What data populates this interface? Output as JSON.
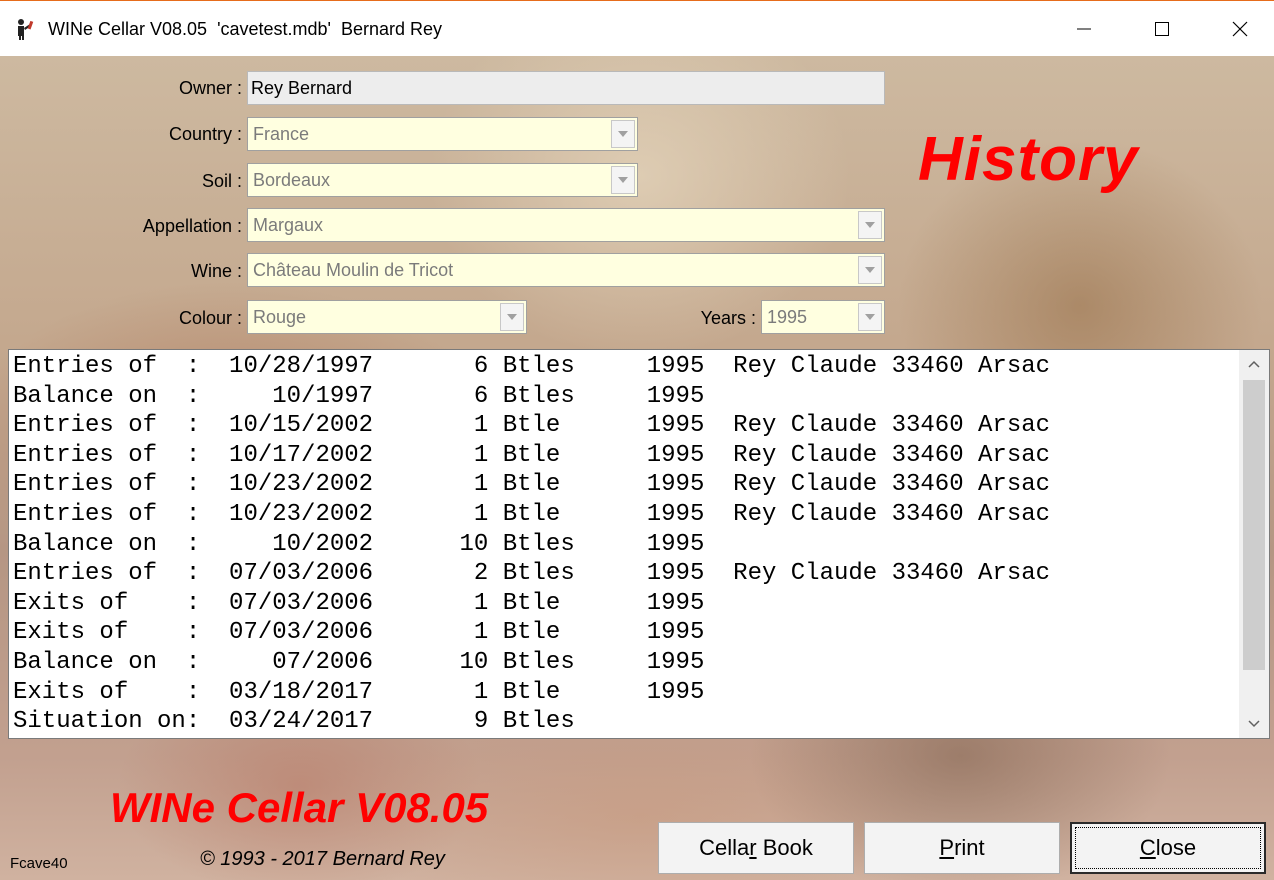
{
  "window": {
    "title": "WINe Cellar V08.05  'cavetest.mdb'  Bernard Rey",
    "controls": [
      "minimize-icon",
      "maximize-icon",
      "close-icon"
    ]
  },
  "form": {
    "owner": {
      "label": "Owner :",
      "value": "Rey Bernard"
    },
    "country": {
      "label": "Country :",
      "value": "France"
    },
    "soil": {
      "label": "Soil :",
      "value": "Bordeaux"
    },
    "appellation": {
      "label": "Appellation :",
      "value": "Margaux"
    },
    "wine": {
      "label": "Wine :",
      "value": "Château Moulin de Tricot"
    },
    "colour": {
      "label": "Colour :",
      "value": "Rouge"
    },
    "years": {
      "label": "Years :",
      "value": "1995"
    }
  },
  "heading": "History",
  "history": {
    "rows": [
      {
        "label": "Entries of  :",
        "date": "10/28/1997",
        "qty": " 6",
        "unit": "Btles",
        "year": "1995",
        "supplier": "Rey Claude 33460 Arsac"
      },
      {
        "label": "Balance on  :",
        "date": "   10/1997",
        "qty": " 6",
        "unit": "Btles",
        "year": "1995",
        "supplier": ""
      },
      {
        "label": "Entries of  :",
        "date": "10/15/2002",
        "qty": " 1",
        "unit": "Btle ",
        "year": "1995",
        "supplier": "Rey Claude 33460 Arsac"
      },
      {
        "label": "Entries of  :",
        "date": "10/17/2002",
        "qty": " 1",
        "unit": "Btle ",
        "year": "1995",
        "supplier": "Rey Claude 33460 Arsac"
      },
      {
        "label": "Entries of  :",
        "date": "10/23/2002",
        "qty": " 1",
        "unit": "Btle ",
        "year": "1995",
        "supplier": "Rey Claude 33460 Arsac"
      },
      {
        "label": "Entries of  :",
        "date": "10/23/2002",
        "qty": " 1",
        "unit": "Btle ",
        "year": "1995",
        "supplier": "Rey Claude 33460 Arsac"
      },
      {
        "label": "Balance on  :",
        "date": "   10/2002",
        "qty": "10",
        "unit": "Btles",
        "year": "1995",
        "supplier": ""
      },
      {
        "label": "Entries of  :",
        "date": "07/03/2006",
        "qty": " 2",
        "unit": "Btles",
        "year": "1995",
        "supplier": "Rey Claude 33460 Arsac"
      },
      {
        "label": "Exits of    :",
        "date": "07/03/2006",
        "qty": " 1",
        "unit": "Btle ",
        "year": "1995",
        "supplier": ""
      },
      {
        "label": "Exits of    :",
        "date": "07/03/2006",
        "qty": " 1",
        "unit": "Btle ",
        "year": "1995",
        "supplier": ""
      },
      {
        "label": "Balance on  :",
        "date": "   07/2006",
        "qty": "10",
        "unit": "Btles",
        "year": "1995",
        "supplier": ""
      },
      {
        "label": "Exits of    :",
        "date": "03/18/2017",
        "qty": " 1",
        "unit": "Btle ",
        "year": "1995",
        "supplier": ""
      },
      {
        "label": "Situation on:",
        "date": "03/24/2017",
        "qty": " 9",
        "unit": "Btles",
        "year": "",
        "supplier": ""
      }
    ]
  },
  "footer": {
    "brand": "WINe Cellar V08.05",
    "copyright": "© 1993 - 2017 Bernard Rey",
    "form_id": "Fcave40"
  },
  "buttons": {
    "cellar_book": {
      "before": "Cella",
      "accel": "r",
      "after": " Book"
    },
    "print": {
      "before": "",
      "accel": "P",
      "after": "rint"
    },
    "close": {
      "before": "",
      "accel": "C",
      "after": "lose"
    }
  },
  "colors": {
    "accent": "#ff0000",
    "field_bg": "#ffffe0",
    "titlebar_border": "#e66c1b"
  }
}
